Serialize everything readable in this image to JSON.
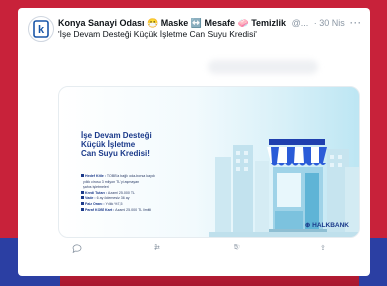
{
  "tweet": {
    "author_name": "Konya Sanayi Odası",
    "author_name_extra": "😷 Maske ↔️ Mesafe 🧼 Temizlik",
    "handle": "@...",
    "date": "· 30 Nis",
    "more_label": "···",
    "text": "İşe Devam Desteği Küçük İşletme Can Suyu Kredisi"
  },
  "media": {
    "title_lines": [
      "İşe Devam Desteği",
      "Küçük İşletme",
      "Can Suyu Kredisi!"
    ],
    "bullets": [
      {
        "label": "Hedef Kitle :",
        "text": "TOBB'a bağlı oda-borsa kaydı"
      },
      {
        "label": "",
        "text": "yıllık cirosu 3 milyon TL'yi aşmayan"
      },
      {
        "label": "",
        "text": "şahıs işletmeleri"
      },
      {
        "label": "Kredi Tutarı :",
        "text": "Azami 25.000 TL"
      },
      {
        "label": "Vade :",
        "text": "6 ay ödemesiz 36 ay"
      },
      {
        "label": "Faiz Oranı :",
        "text": "Yıllık %7,5"
      },
      {
        "label": "Paraf KOBİ Kart :",
        "text": "Azami 25.000 TL limitli"
      }
    ],
    "brand": "HALKBANK"
  },
  "actions": {
    "reply_count": "",
    "retweet_count": "1",
    "like_count": "5",
    "share_label": ""
  },
  "colors": {
    "frame_red": "#c8223a",
    "frame_blue": "#2b3fa3",
    "brand_navy": "#1b3a8a",
    "awning_blue": "#2a5bd8"
  }
}
